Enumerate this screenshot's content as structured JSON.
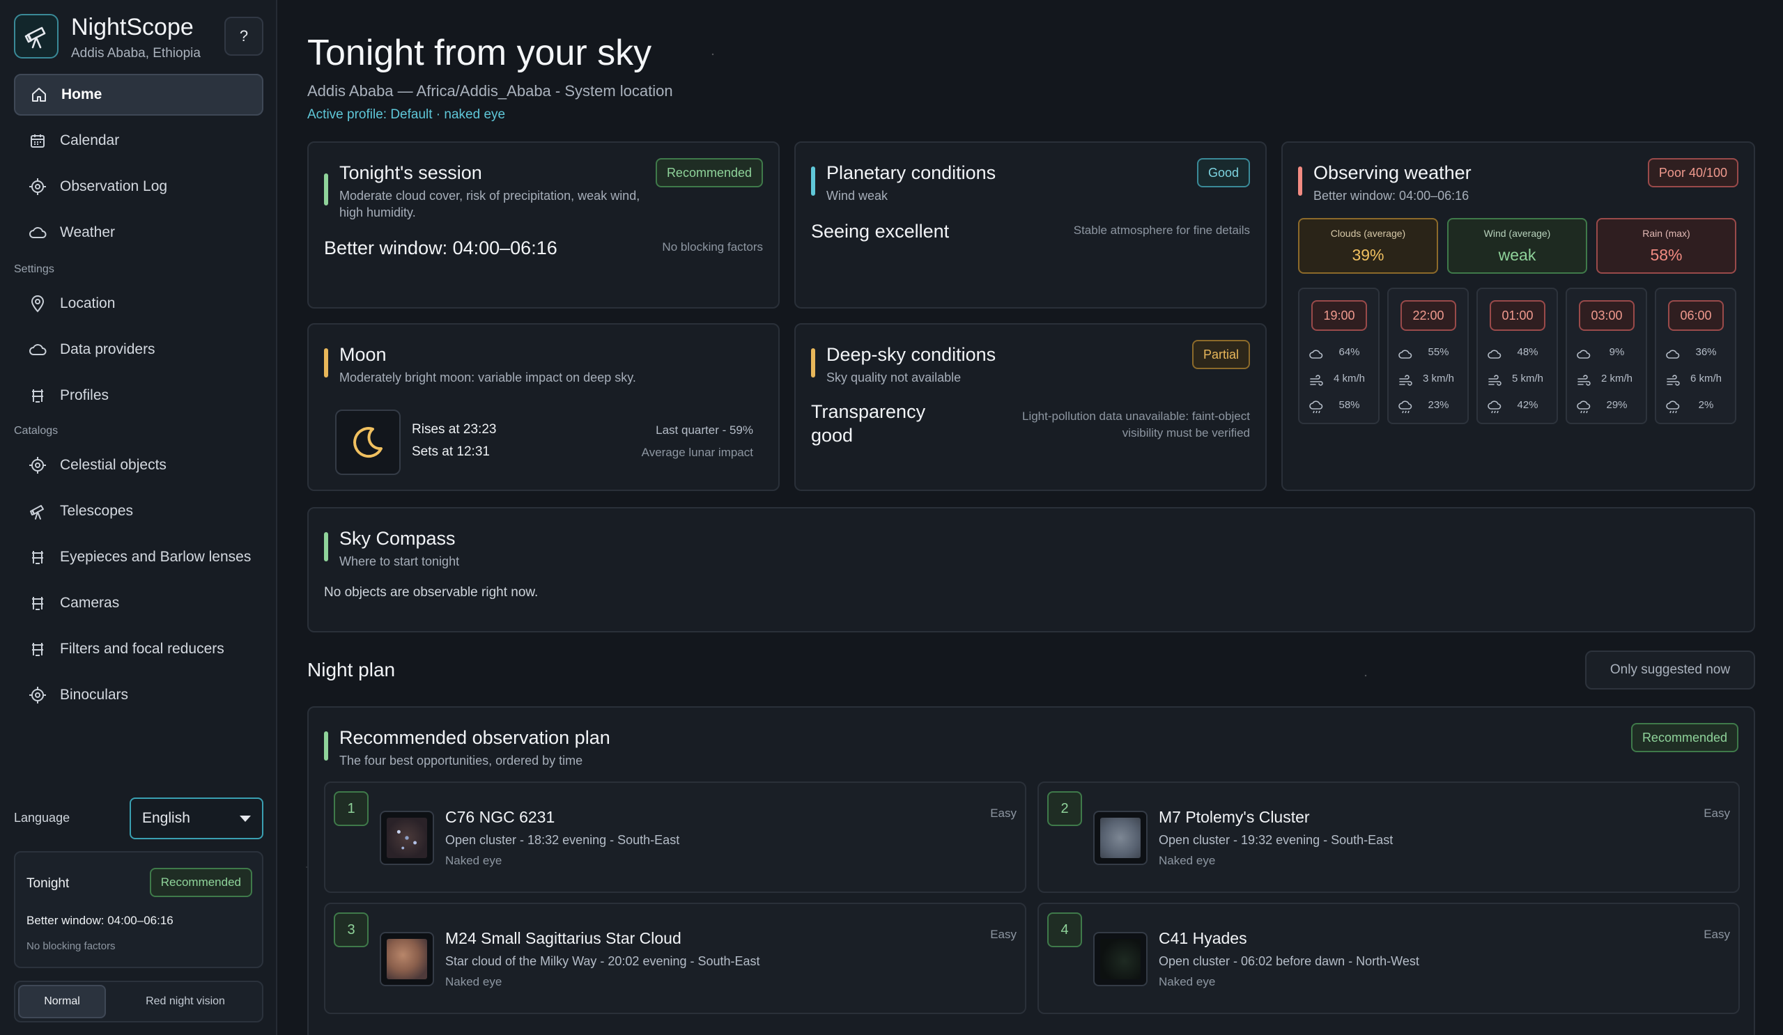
{
  "app": {
    "name": "NightScope",
    "location": "Addis Ababa, Ethiopia",
    "help_label": "?"
  },
  "nav": {
    "main": [
      {
        "label": "Home",
        "icon": "home-icon",
        "active": true
      },
      {
        "label": "Calendar",
        "icon": "calendar-icon"
      },
      {
        "label": "Observation Log",
        "icon": "target-icon"
      },
      {
        "label": "Weather",
        "icon": "cloud-icon"
      }
    ],
    "settings_title": "Settings",
    "settings": [
      {
        "label": "Location",
        "icon": "pin-icon"
      },
      {
        "label": "Data providers",
        "icon": "cloud-icon"
      },
      {
        "label": "Profiles",
        "icon": "equipment-icon"
      }
    ],
    "catalogs_title": "Catalogs",
    "catalogs": [
      {
        "label": "Celestial objects",
        "icon": "target-icon"
      },
      {
        "label": "Telescopes",
        "icon": "telescope-icon"
      },
      {
        "label": "Eyepieces and Barlow lenses",
        "icon": "equipment-icon"
      },
      {
        "label": "Cameras",
        "icon": "equipment-icon"
      },
      {
        "label": "Filters and focal reducers",
        "icon": "equipment-icon"
      },
      {
        "label": "Binoculars",
        "icon": "target-icon"
      }
    ]
  },
  "sidebar_footer": {
    "language_label": "Language",
    "language_value": "English",
    "tonight_title": "Tonight",
    "tonight_badge": "Recommended",
    "tonight_window": "Better window: 04:00–06:16",
    "tonight_note": "No blocking factors",
    "mode_normal": "Normal",
    "mode_red": "Red night vision"
  },
  "header": {
    "title": "Tonight from your sky",
    "location_line": "Addis Ababa — Africa/Addis_Ababa  -  System location",
    "profile_line": "Active profile: Default · naked eye"
  },
  "session": {
    "title": "Tonight's session",
    "subtitle_1": "Moderate cloud cover, risk of precipitation, weak wind,",
    "subtitle_2": "high humidity.",
    "badge": "Recommended",
    "window": "Better window: 04:00–06:16",
    "note": "No blocking factors"
  },
  "planetary": {
    "title": "Planetary conditions",
    "subtitle": "Wind weak",
    "badge": "Good",
    "seeing": "Seeing excellent",
    "note": "Stable atmosphere for fine details"
  },
  "weather": {
    "title": "Observing weather",
    "subtitle": "Better window: 04:00–06:16",
    "badge": "Poor 40/100",
    "tiles": [
      {
        "label": "Clouds (average)",
        "value": "39%",
        "tone": "amber"
      },
      {
        "label": "Wind (average)",
        "value": "weak",
        "tone": "green"
      },
      {
        "label": "Rain (max)",
        "value": "58%",
        "tone": "red"
      }
    ],
    "hours": [
      {
        "time": "19:00",
        "clouds": "64%",
        "wind": "4 km/h",
        "rain": "58%"
      },
      {
        "time": "22:00",
        "clouds": "55%",
        "wind": "3 km/h",
        "rain": "23%"
      },
      {
        "time": "01:00",
        "clouds": "48%",
        "wind": "5 km/h",
        "rain": "42%"
      },
      {
        "time": "03:00",
        "clouds": "9%",
        "wind": "2 km/h",
        "rain": "29%"
      },
      {
        "time": "06:00",
        "clouds": "36%",
        "wind": "6 km/h",
        "rain": "2%"
      }
    ]
  },
  "moon": {
    "title": "Moon",
    "subtitle": "Moderately bright moon: variable impact on deep sky.",
    "rises": "Rises at 23:23",
    "sets": "Sets at 12:31",
    "phase": "Last quarter  -  59%",
    "impact": "Average lunar impact"
  },
  "deepsky": {
    "title": "Deep-sky conditions",
    "subtitle": "Sky quality not available",
    "badge": "Partial",
    "transparency_1": "Transparency",
    "transparency_2": "good",
    "note_1": "Light-pollution data unavailable: faint-object",
    "note_2": "visibility must be verified"
  },
  "compass": {
    "title": "Sky Compass",
    "subtitle": "Where to start tonight",
    "empty": "No objects are observable right now."
  },
  "night_plan": {
    "title": "Night plan",
    "filter_button": "Only suggested now",
    "card_title": "Recommended observation plan",
    "card_subtitle": "The four best opportunities, ordered by time",
    "badge": "Recommended",
    "objects": [
      {
        "num": "1",
        "name": "C76 NGC 6231",
        "desc": "Open cluster - 18:32 evening  -  South-East",
        "eye": "Naked eye",
        "difficulty": "Easy"
      },
      {
        "num": "2",
        "name": "M7 Ptolemy's Cluster",
        "desc": "Open cluster - 19:32 evening  -  South-East",
        "eye": "Naked eye",
        "difficulty": "Easy"
      },
      {
        "num": "3",
        "name": "M24 Small Sagittarius Star Cloud",
        "desc": "Star cloud of the Milky Way - 20:02 evening  -  South-East",
        "eye": "Naked eye",
        "difficulty": "Easy"
      },
      {
        "num": "4",
        "name": "C41 Hyades",
        "desc": "Open cluster - 06:02 before dawn  -  North-West",
        "eye": "Naked eye",
        "difficulty": "Easy"
      }
    ]
  },
  "colors": {
    "accent_teal": "#3aa0b2",
    "accent_green": "#8fd39a",
    "accent_amber": "#e8b75a",
    "accent_red": "#f09a8e"
  }
}
